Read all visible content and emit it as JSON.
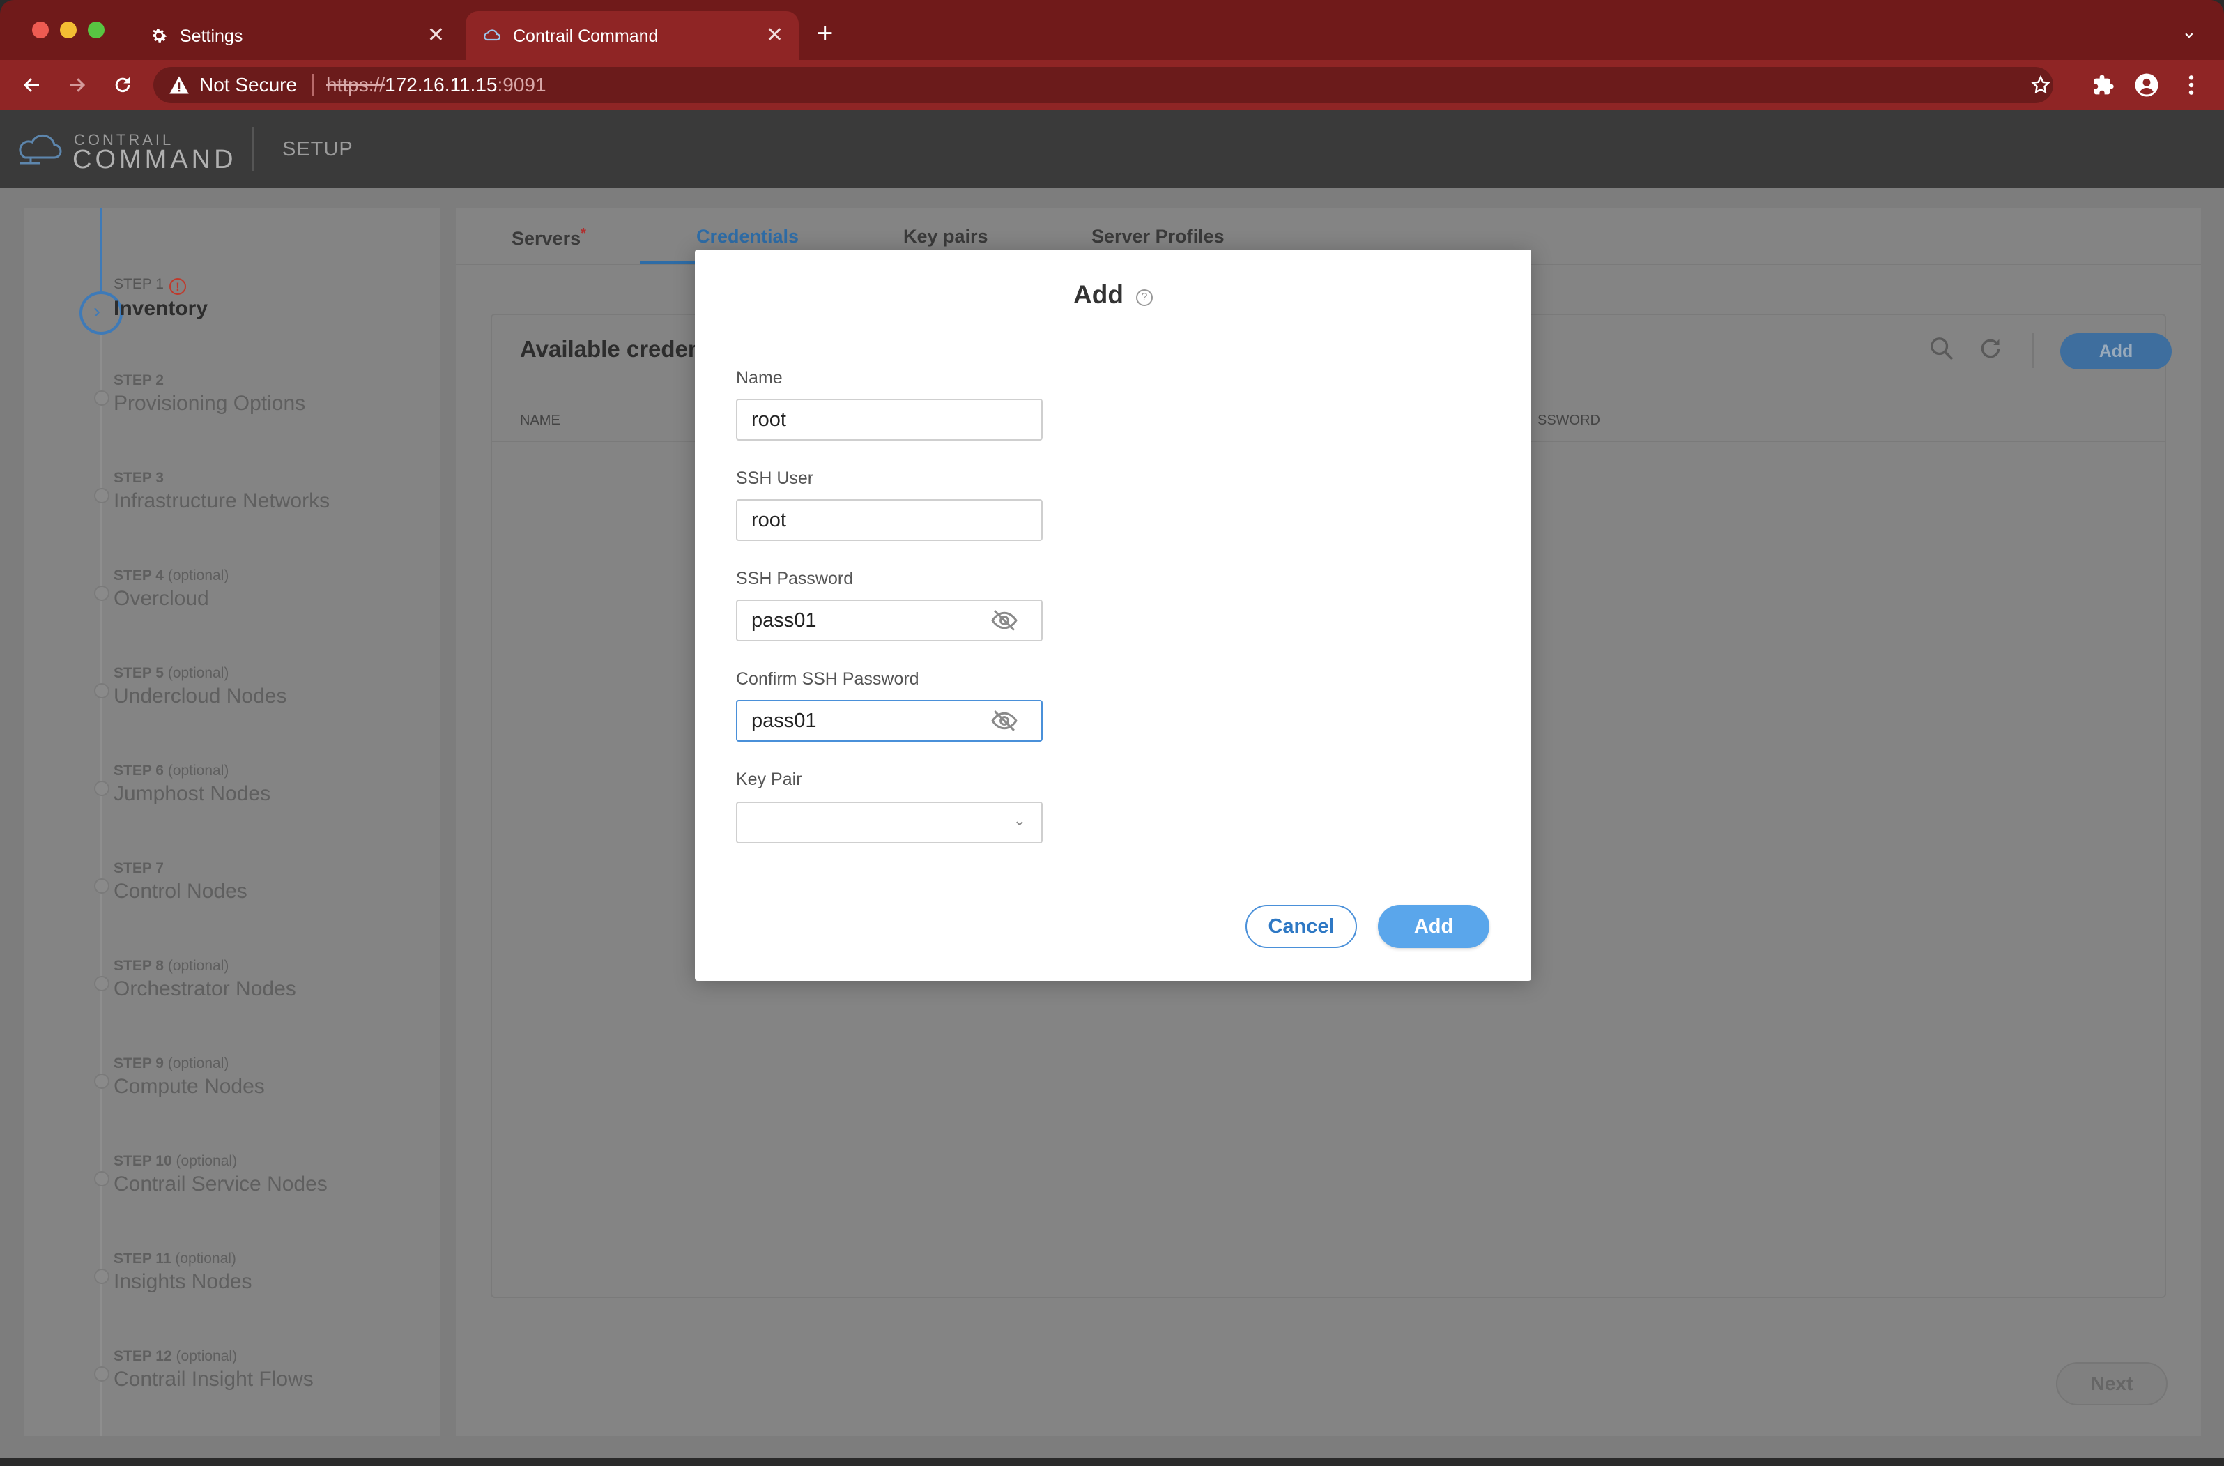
{
  "browser": {
    "tabs": [
      {
        "label": "Settings",
        "icon": "gear-icon"
      },
      {
        "label": "Contrail Command",
        "icon": "cloud-icon",
        "active": true
      }
    ],
    "address": {
      "security_label": "Not Secure",
      "scheme": "https://",
      "host": "172.16.11.15",
      "port": ":9091"
    }
  },
  "app": {
    "brand_small": "CONTRAIL",
    "brand_big": "COMMAND",
    "section": "SETUP"
  },
  "sidebar": {
    "steps": [
      {
        "num": "STEP 1",
        "opt": "",
        "name": "Inventory",
        "active": true,
        "error": "!"
      },
      {
        "num": "STEP 2",
        "opt": "",
        "name": "Provisioning Options"
      },
      {
        "num": "STEP 3",
        "opt": "",
        "name": "Infrastructure Networks"
      },
      {
        "num": "STEP 4",
        "opt": "(optional)",
        "name": "Overcloud"
      },
      {
        "num": "STEP 5",
        "opt": "(optional)",
        "name": "Undercloud Nodes"
      },
      {
        "num": "STEP 6",
        "opt": "(optional)",
        "name": "Jumphost Nodes"
      },
      {
        "num": "STEP 7",
        "opt": "",
        "name": "Control Nodes"
      },
      {
        "num": "STEP 8",
        "opt": "(optional)",
        "name": "Orchestrator Nodes"
      },
      {
        "num": "STEP 9",
        "opt": "(optional)",
        "name": "Compute Nodes"
      },
      {
        "num": "STEP 10",
        "opt": "(optional)",
        "name": "Contrail Service Nodes"
      },
      {
        "num": "STEP 11",
        "opt": "(optional)",
        "name": "Insights Nodes"
      },
      {
        "num": "STEP 12",
        "opt": "(optional)",
        "name": "Contrail Insight Flows"
      }
    ]
  },
  "main": {
    "tabs": [
      {
        "label": "Servers",
        "required": "*"
      },
      {
        "label": "Credentials",
        "active": true
      },
      {
        "label": "Key pairs"
      },
      {
        "label": "Server Profiles"
      }
    ],
    "card_title": "Available creden",
    "col_name": "NAME",
    "col_password": "SSWORD",
    "add_label": "Add",
    "next_label": "Next"
  },
  "modal": {
    "title": "Add",
    "fields": {
      "name": {
        "label": "Name",
        "value": "root"
      },
      "ssh_user": {
        "label": "SSH User",
        "value": "root"
      },
      "ssh_password": {
        "label": "SSH Password",
        "value": "pass01"
      },
      "confirm_password": {
        "label": "Confirm SSH Password",
        "value": "pass01"
      },
      "key_pair": {
        "label": "Key Pair",
        "value": ""
      }
    },
    "cancel_label": "Cancel",
    "add_label": "Add"
  },
  "colors": {
    "tabstrip": "#701a1a",
    "toolbar": "#8f2525",
    "accent": "#4a90d9",
    "primary_button": "#5aa6eb"
  }
}
